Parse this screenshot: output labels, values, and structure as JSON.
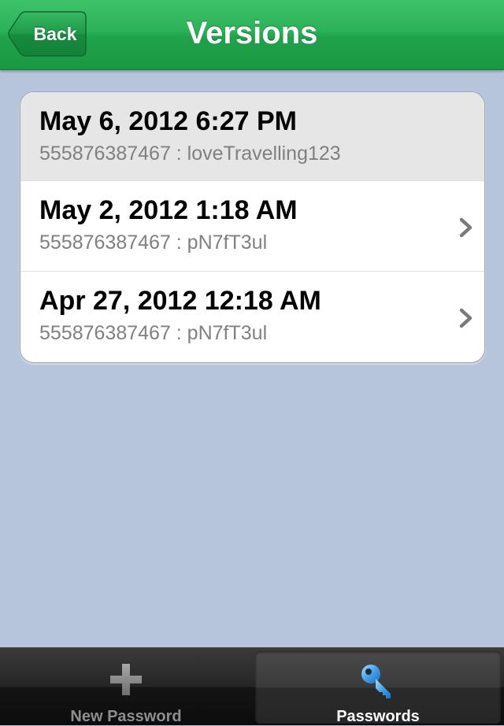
{
  "nav": {
    "title": "Versions",
    "back_label": "Back"
  },
  "versions": [
    {
      "date": "May 6, 2012 6:27 PM",
      "detail": "555876387467 : loveTravelling123",
      "selected": true,
      "has_chevron": false
    },
    {
      "date": "May 2, 2012 1:18 AM",
      "detail": "555876387467 : pN7fT3ul",
      "selected": false,
      "has_chevron": true
    },
    {
      "date": "Apr 27, 2012 12:18 AM",
      "detail": "555876387467 : pN7fT3ul",
      "selected": false,
      "has_chevron": true
    }
  ],
  "tabbar": {
    "tabs": [
      {
        "label": "New Password",
        "icon": "plus-icon",
        "active": false
      },
      {
        "label": "Passwords",
        "icon": "key-icon",
        "active": true
      }
    ]
  },
  "colors": {
    "nav_green": "#2bb157",
    "background": "#b6c5dc",
    "subtitle_gray": "#808080",
    "selected_row": "#e6e6e6"
  }
}
